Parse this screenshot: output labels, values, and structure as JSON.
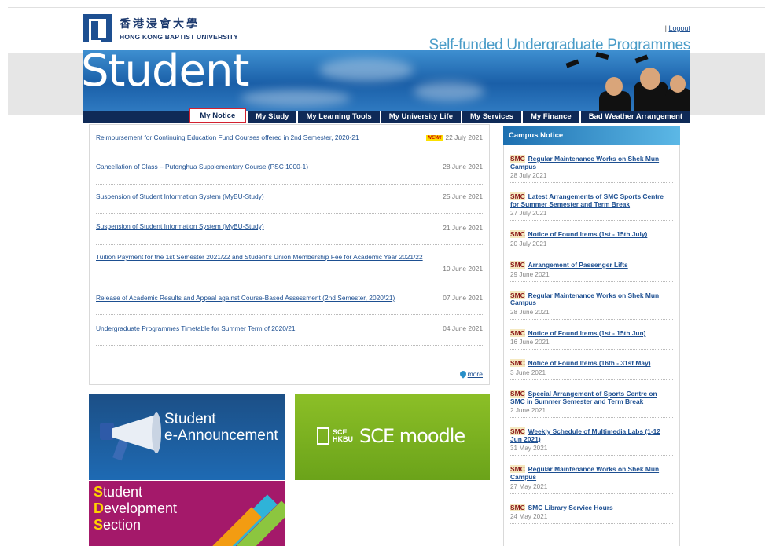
{
  "header": {
    "logo_cn": "香港浸會大學",
    "logo_en": "HONG KONG BAPTIST UNIVERSITY",
    "separator": "|",
    "logout": "Logout",
    "programme_title": "Self-funded Undergraduate Programmes"
  },
  "banner": {
    "title": "Student"
  },
  "tabs": [
    {
      "label": "My Notice",
      "active": true
    },
    {
      "label": "My Study"
    },
    {
      "label": "My Learning Tools"
    },
    {
      "label": "My University Life"
    },
    {
      "label": "My Services"
    },
    {
      "label": "My Finance"
    },
    {
      "label": "Bad Weather Arrangement"
    }
  ],
  "notices": [
    {
      "title": "Reimbursement for Continuing Education Fund Courses offered in 2nd Semester, 2020-21",
      "date": "22 July 2021",
      "is_new": true,
      "new_label": "NEW!"
    },
    {
      "title": "Cancellation of Class – Putonghua Supplementary Course (PSC 1000-1)",
      "date": "28 June 2021"
    },
    {
      "title": "Suspension of Student Information System (MyBU-Study)",
      "date": "25 June 2021"
    },
    {
      "title": "Suspension of Student Information System (MyBU-Study)",
      "date": "21 June 2021"
    },
    {
      "title": "Tuition Payment for the 1st Semester 2021/22 and Student's Union Membership Fee for Academic Year 2021/22",
      "date": "10 June 2021"
    },
    {
      "title": "Release of Academic Results and Appeal against Course-Based Assessment (2nd Semester, 2020/21)",
      "date": "07 June 2021"
    },
    {
      "title": "Undergraduate Programmes Timetable for Summer Term of 2020/21",
      "date": "04 June 2021"
    }
  ],
  "more_label": "more",
  "tiles": {
    "announcement_line1": "Student",
    "announcement_line2": "e-Announcement",
    "sce_small_1": "SCE",
    "sce_small_2": "HKBU",
    "sce_big": "SCE moodle",
    "dev_line1_cap": "S",
    "dev_line1_rest": "tudent",
    "dev_line2_cap": "D",
    "dev_line2_rest": "evelopment",
    "dev_line3_cap": "S",
    "dev_line3_rest": "ection"
  },
  "campus": {
    "heading": "Campus Notice",
    "tag": "SMC",
    "items": [
      {
        "title": "Regular Maintenance Works on Shek Mun Campus",
        "date": "28 July 2021"
      },
      {
        "title": "Latest Arrangements of SMC Sports Centre for Summer Semester and Term Break",
        "date": "27 July 2021"
      },
      {
        "title": "Notice of Found Items (1st - 15th July)",
        "date": "20 July 2021"
      },
      {
        "title": "Arrangement of Passenger Lifts",
        "date": "29 June 2021"
      },
      {
        "title": "Regular Maintenance Works on Shek Mun Campus",
        "date": "28 June 2021"
      },
      {
        "title": "Notice of Found Items (1st - 15th Jun)",
        "date": "16 June 2021"
      },
      {
        "title": "Notice of Found Items (16th - 31st May)",
        "date": "3 June 2021"
      },
      {
        "title": "Special Arrangement of Sports Centre on SMC in Summer Semester and Term Break",
        "date": "2 June 2021"
      },
      {
        "title": "Weekly Schedule of Multimedia Labs (1-12 Jun 2021)",
        "date": "31 May 2021"
      },
      {
        "title": "Regular Maintenance Works on Shek Mun Campus",
        "date": "27 May 2021"
      },
      {
        "title": "SMC Library Service Hours",
        "date": "24 May 2021"
      }
    ]
  }
}
